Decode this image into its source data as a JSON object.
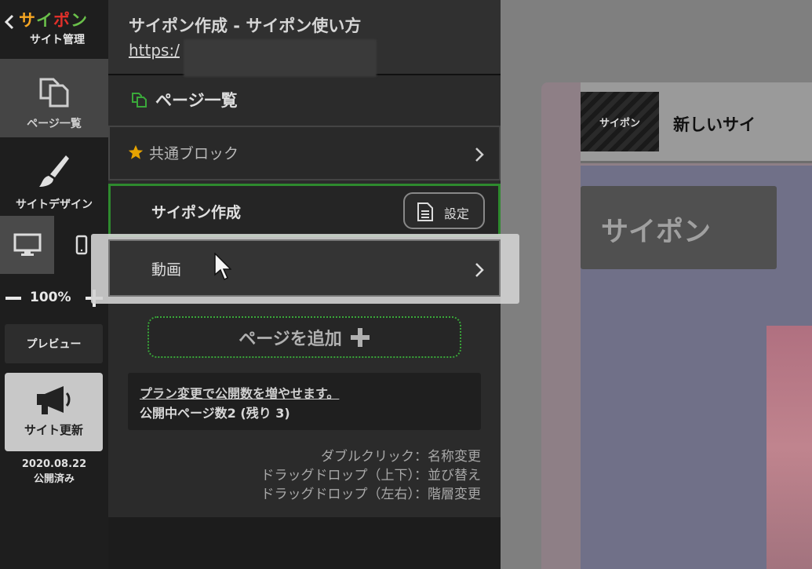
{
  "rail": {
    "logo_text": "サイポン",
    "logo_sub": "サイト管理",
    "pages_label": "ページ一覧",
    "design_label": "サイトデザイン",
    "zoom_value": "100%",
    "preview_label": "プレビュー",
    "update_label": "サイト更新",
    "publish_date": "2020.08.22",
    "publish_status": "公開済み"
  },
  "panel": {
    "site_title": "サイポン作成 - サイポン使い方",
    "site_url": "https:/",
    "list_title": "ページ一覧",
    "rows": [
      {
        "label": "共通ブロック"
      },
      {
        "label": "サイポン作成",
        "settings_label": "設定"
      },
      {
        "label": "動画"
      }
    ],
    "add_page_label": "ページを追加",
    "plan_link": "プラン変更で公開数を増やせます。",
    "plan_count": "公開中ページ数2 (残り 3)",
    "hints": [
      "ダブルクリック：名称変更",
      "ドラッグドロップ（上下）：並び替え",
      "ドラッグドロップ（左右）：階層変更"
    ]
  },
  "preview": {
    "logo_text": "サイポン",
    "site_name": "新しいサイ",
    "title": "サイポン"
  },
  "colors": {
    "accent_green": "#2e8a2e",
    "logo_orange": "#f5a623",
    "logo_green": "#6ac04a",
    "logo_red": "#e0302a",
    "star": "#e6a300"
  }
}
